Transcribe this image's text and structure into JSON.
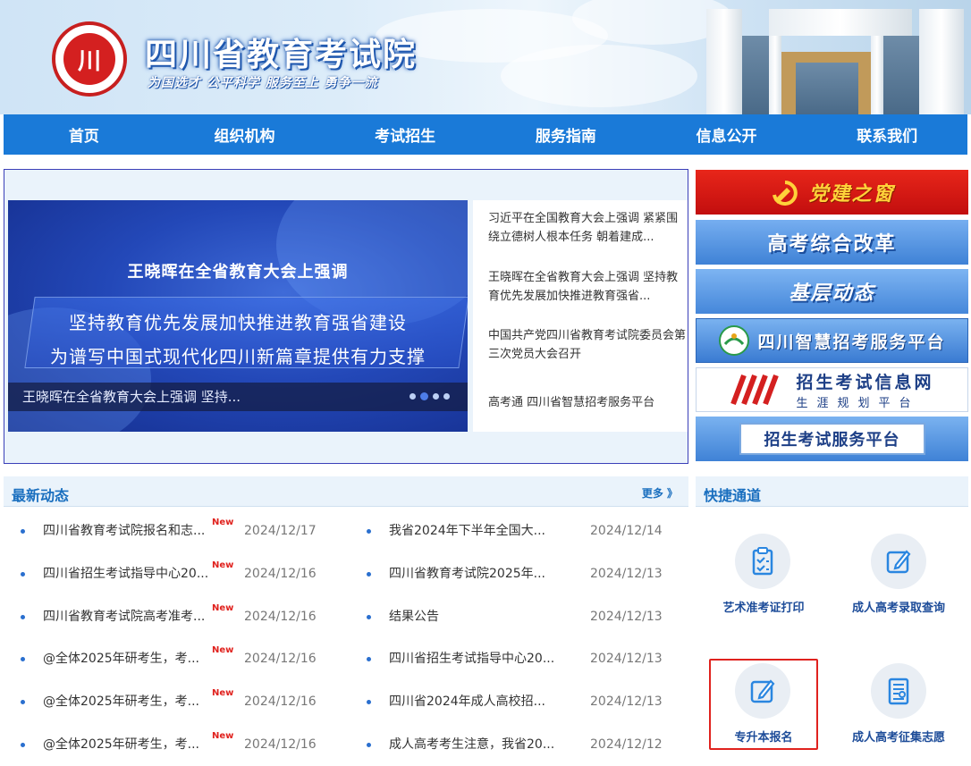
{
  "header": {
    "site_title": "四川省教育考试院",
    "slogan": "为国选才 公平科学 服务至上 勇争一流",
    "logo_text": "川",
    "logo_icon": "institute-seal-icon"
  },
  "nav": {
    "items": [
      {
        "label": "首页"
      },
      {
        "label": "组织机构"
      },
      {
        "label": "考试招生"
      },
      {
        "label": "服务指南"
      },
      {
        "label": "信息公开"
      },
      {
        "label": "联系我们"
      }
    ]
  },
  "slider": {
    "headline": "王晓晖在全省教育大会上强调",
    "line1": "坚持教育优先发展加快推进教育强省建设",
    "line2": "为谱写中国式现代化四川新篇章提供有力支撑",
    "caption": "王晓晖在全省教育大会上强调 坚持...",
    "active_dot": 2
  },
  "feature_list": [
    {
      "text": "习近平在全国教育大会上强调 紧紧围绕立德树人根本任务 朝着建成..."
    },
    {
      "text": "王晓晖在全省教育大会上强调 坚持教育优先发展加快推进教育强省..."
    },
    {
      "text": "中国共产党四川省教育考试院委员会第三次党员大会召开"
    },
    {
      "text": "高考通 四川省智慧招考服务平台"
    }
  ],
  "right_banners": {
    "b1": "党建之窗",
    "b2": "高考综合改革",
    "b3": "基层动态",
    "b4": "四川智慧招考服务平台",
    "b5_main": "招生考试信息网",
    "b5_sub": "生涯规划平台",
    "b6": "招生考试服务平台"
  },
  "news": {
    "title": "最新动态",
    "more_label": "更多 》",
    "badge": "New",
    "left": [
      {
        "text": "四川省教育考试院报名和志...",
        "date": "2024/12/17"
      },
      {
        "text": "四川省招生考试指导中心20...",
        "date": "2024/12/16"
      },
      {
        "text": "四川省教育考试院高考准考...",
        "date": "2024/12/16"
      },
      {
        "text": "@全体2025年研考生，考...",
        "date": "2024/12/16"
      },
      {
        "text": "@全体2025年研考生，考...",
        "date": "2024/12/16"
      },
      {
        "text": "@全体2025年研考生，考...",
        "date": "2024/12/16"
      }
    ],
    "right": [
      {
        "text": "我省2024年下半年全国大...",
        "date": "2024/12/14"
      },
      {
        "text": "四川省教育考试院2025年...",
        "date": "2024/12/13"
      },
      {
        "text": "结果公告",
        "date": "2024/12/13"
      },
      {
        "text": "四川省招生考试指导中心20...",
        "date": "2024/12/13"
      },
      {
        "text": "四川省2024年成人高校招...",
        "date": "2024/12/13"
      },
      {
        "text": "成人高考考生注意，我省20...",
        "date": "2024/12/12"
      }
    ]
  },
  "quick": {
    "title": "快捷通道",
    "items": [
      {
        "label": "艺术准考证打印",
        "icon": "clipboard-check-icon"
      },
      {
        "label": "成人高考录取查询",
        "icon": "edit-icon"
      },
      {
        "label": "专升本报名",
        "icon": "edit-icon"
      },
      {
        "label": "成人高考征集志愿",
        "icon": "document-icon"
      }
    ]
  },
  "colors": {
    "nav_blue": "#1a7ad8",
    "title_blue": "#1a6fbf",
    "badge_red": "#e0221e",
    "highlight_red": "#e0221e"
  }
}
